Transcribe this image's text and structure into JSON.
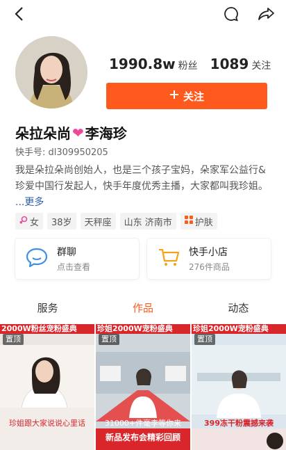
{
  "profile": {
    "name_left": "朵拉朵尚",
    "name_right": "李海珍",
    "kuaishou_id": "快手号: dl309950205",
    "bio": "我是朵拉朵尚创始人，也是三个孩子宝妈，朵家军公益行&珍爱中国行发起人，快手年度优秀主播，大家都叫我珍姐。",
    "bio_more": "...更多"
  },
  "stats": {
    "fans_value": "1990.8w",
    "fans_label": "粉丝",
    "following_value": "1089",
    "following_label": "关注"
  },
  "follow_button": {
    "label": "关注",
    "icon": "plus-icon",
    "color": "#fe5a1d"
  },
  "tags": [
    "女",
    "38岁",
    "天秤座",
    "山东 济南市",
    "护肤"
  ],
  "cards": {
    "group_chat": {
      "title": "群聊",
      "subtitle": "点击查看",
      "icon": "chat-bubble-icon"
    },
    "shop": {
      "title": "快手小店",
      "subtitle": "276件商品",
      "icon": "shopping-cart-icon"
    }
  },
  "tabs": [
    {
      "label": "服务",
      "active": false
    },
    {
      "label": "作品",
      "active": true
    },
    {
      "label": "动态",
      "active": false
    }
  ],
  "videos": [
    {
      "banner": "2000W粉丝宠粉盛典",
      "pin": "置顶",
      "caption": "珍姐跟大家说说心里话"
    },
    {
      "banner": "珍姐2000W宠粉盛典",
      "pin": "置顶",
      "caption": "31000+件毫李等你来",
      "caption2": "新品发布会精彩回顾"
    },
    {
      "banner": "珍姐2000W宠粉盛典",
      "pin": "置顶",
      "caption": "399冻干粉震撼来袭"
    }
  ],
  "colors": {
    "accent": "#fe5a1d",
    "heart": "#f0479a",
    "link": "#2c5fa8",
    "banner": "#d9262a"
  }
}
